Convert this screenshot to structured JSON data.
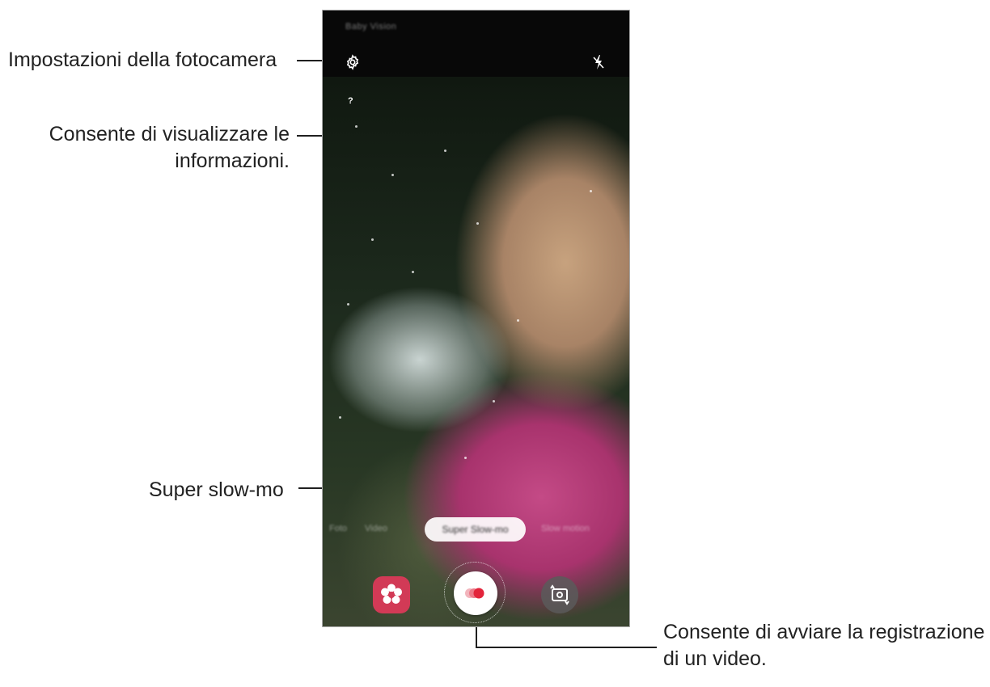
{
  "camera": {
    "mode_title": "Baby Vision",
    "info_label": "?",
    "mode_pill": "Super Slow-mo",
    "modes_left": "Foto",
    "modes_mid": "Video",
    "modes_right": "Slow motion"
  },
  "callouts": {
    "settings": "Impostazioni della fotocamera",
    "info_line1": "Consente di visualizzare le",
    "info_line2": "informazioni.",
    "slowmo": "Super slow-mo",
    "record_line1": "Consente di avviare la registrazione",
    "record_line2": "di un video."
  },
  "colors": {
    "bixby": "#d23a56",
    "record_dot": "#e3243b"
  },
  "icons": {
    "settings": "gear-icon",
    "flash": "flash-off-icon",
    "bixby": "bixby-vision-icon",
    "record": "record-icon",
    "switch": "switch-camera-icon"
  }
}
